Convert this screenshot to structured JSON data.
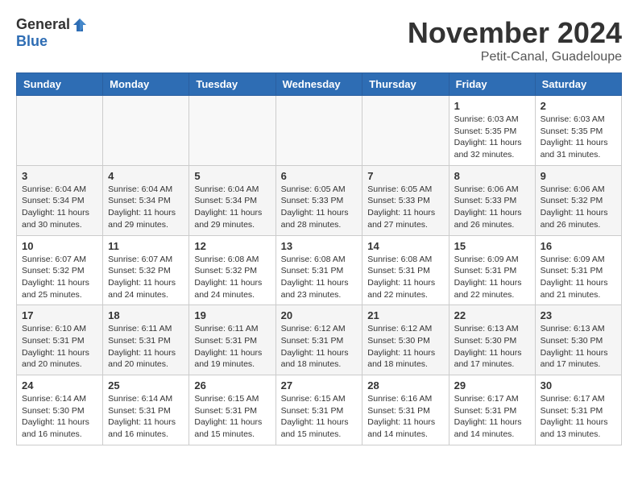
{
  "header": {
    "logo_general": "General",
    "logo_blue": "Blue",
    "month": "November 2024",
    "location": "Petit-Canal, Guadeloupe"
  },
  "weekdays": [
    "Sunday",
    "Monday",
    "Tuesday",
    "Wednesday",
    "Thursday",
    "Friday",
    "Saturday"
  ],
  "weeks": [
    [
      {
        "day": "",
        "info": ""
      },
      {
        "day": "",
        "info": ""
      },
      {
        "day": "",
        "info": ""
      },
      {
        "day": "",
        "info": ""
      },
      {
        "day": "",
        "info": ""
      },
      {
        "day": "1",
        "info": "Sunrise: 6:03 AM\nSunset: 5:35 PM\nDaylight: 11 hours and 32 minutes."
      },
      {
        "day": "2",
        "info": "Sunrise: 6:03 AM\nSunset: 5:35 PM\nDaylight: 11 hours and 31 minutes."
      }
    ],
    [
      {
        "day": "3",
        "info": "Sunrise: 6:04 AM\nSunset: 5:34 PM\nDaylight: 11 hours and 30 minutes."
      },
      {
        "day": "4",
        "info": "Sunrise: 6:04 AM\nSunset: 5:34 PM\nDaylight: 11 hours and 29 minutes."
      },
      {
        "day": "5",
        "info": "Sunrise: 6:04 AM\nSunset: 5:34 PM\nDaylight: 11 hours and 29 minutes."
      },
      {
        "day": "6",
        "info": "Sunrise: 6:05 AM\nSunset: 5:33 PM\nDaylight: 11 hours and 28 minutes."
      },
      {
        "day": "7",
        "info": "Sunrise: 6:05 AM\nSunset: 5:33 PM\nDaylight: 11 hours and 27 minutes."
      },
      {
        "day": "8",
        "info": "Sunrise: 6:06 AM\nSunset: 5:33 PM\nDaylight: 11 hours and 26 minutes."
      },
      {
        "day": "9",
        "info": "Sunrise: 6:06 AM\nSunset: 5:32 PM\nDaylight: 11 hours and 26 minutes."
      }
    ],
    [
      {
        "day": "10",
        "info": "Sunrise: 6:07 AM\nSunset: 5:32 PM\nDaylight: 11 hours and 25 minutes."
      },
      {
        "day": "11",
        "info": "Sunrise: 6:07 AM\nSunset: 5:32 PM\nDaylight: 11 hours and 24 minutes."
      },
      {
        "day": "12",
        "info": "Sunrise: 6:08 AM\nSunset: 5:32 PM\nDaylight: 11 hours and 24 minutes."
      },
      {
        "day": "13",
        "info": "Sunrise: 6:08 AM\nSunset: 5:31 PM\nDaylight: 11 hours and 23 minutes."
      },
      {
        "day": "14",
        "info": "Sunrise: 6:08 AM\nSunset: 5:31 PM\nDaylight: 11 hours and 22 minutes."
      },
      {
        "day": "15",
        "info": "Sunrise: 6:09 AM\nSunset: 5:31 PM\nDaylight: 11 hours and 22 minutes."
      },
      {
        "day": "16",
        "info": "Sunrise: 6:09 AM\nSunset: 5:31 PM\nDaylight: 11 hours and 21 minutes."
      }
    ],
    [
      {
        "day": "17",
        "info": "Sunrise: 6:10 AM\nSunset: 5:31 PM\nDaylight: 11 hours and 20 minutes."
      },
      {
        "day": "18",
        "info": "Sunrise: 6:11 AM\nSunset: 5:31 PM\nDaylight: 11 hours and 20 minutes."
      },
      {
        "day": "19",
        "info": "Sunrise: 6:11 AM\nSunset: 5:31 PM\nDaylight: 11 hours and 19 minutes."
      },
      {
        "day": "20",
        "info": "Sunrise: 6:12 AM\nSunset: 5:31 PM\nDaylight: 11 hours and 18 minutes."
      },
      {
        "day": "21",
        "info": "Sunrise: 6:12 AM\nSunset: 5:30 PM\nDaylight: 11 hours and 18 minutes."
      },
      {
        "day": "22",
        "info": "Sunrise: 6:13 AM\nSunset: 5:30 PM\nDaylight: 11 hours and 17 minutes."
      },
      {
        "day": "23",
        "info": "Sunrise: 6:13 AM\nSunset: 5:30 PM\nDaylight: 11 hours and 17 minutes."
      }
    ],
    [
      {
        "day": "24",
        "info": "Sunrise: 6:14 AM\nSunset: 5:30 PM\nDaylight: 11 hours and 16 minutes."
      },
      {
        "day": "25",
        "info": "Sunrise: 6:14 AM\nSunset: 5:31 PM\nDaylight: 11 hours and 16 minutes."
      },
      {
        "day": "26",
        "info": "Sunrise: 6:15 AM\nSunset: 5:31 PM\nDaylight: 11 hours and 15 minutes."
      },
      {
        "day": "27",
        "info": "Sunrise: 6:15 AM\nSunset: 5:31 PM\nDaylight: 11 hours and 15 minutes."
      },
      {
        "day": "28",
        "info": "Sunrise: 6:16 AM\nSunset: 5:31 PM\nDaylight: 11 hours and 14 minutes."
      },
      {
        "day": "29",
        "info": "Sunrise: 6:17 AM\nSunset: 5:31 PM\nDaylight: 11 hours and 14 minutes."
      },
      {
        "day": "30",
        "info": "Sunrise: 6:17 AM\nSunset: 5:31 PM\nDaylight: 11 hours and 13 minutes."
      }
    ]
  ]
}
